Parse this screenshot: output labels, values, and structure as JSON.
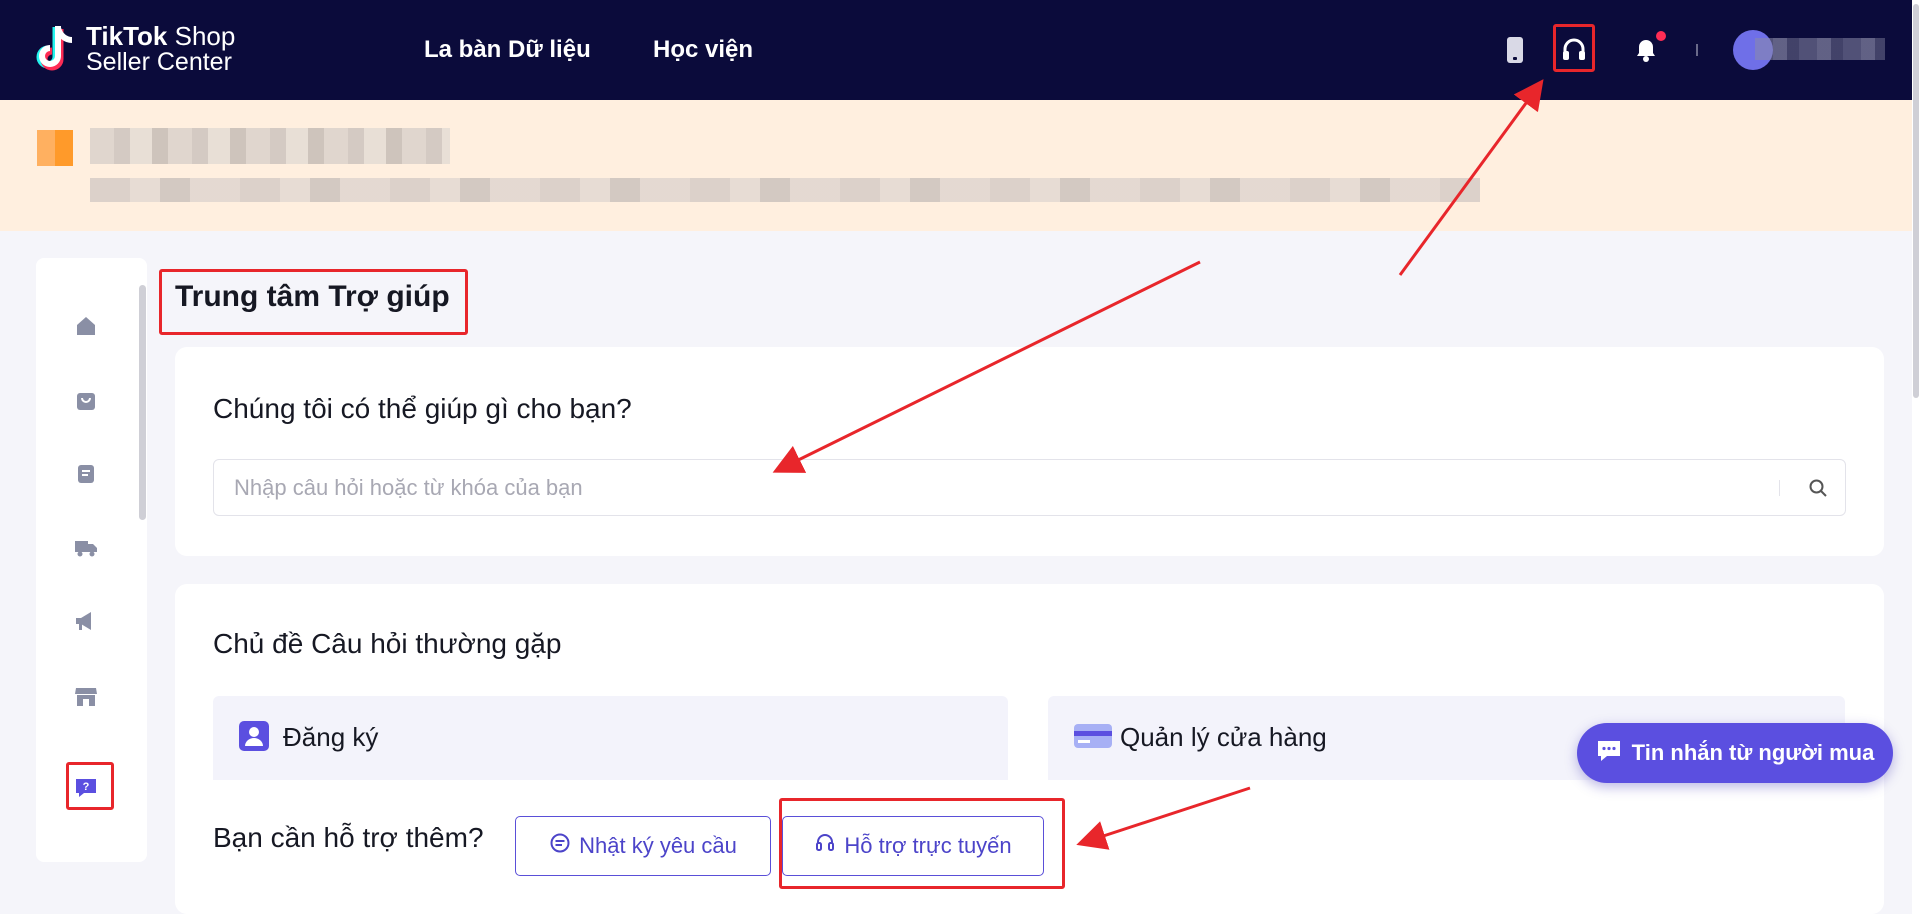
{
  "header": {
    "logo_line1_bold": "TikTok",
    "logo_line1_rest": " Shop",
    "logo_line2": "Seller Center",
    "nav": [
      "La bàn Dữ liệu",
      "Học viện"
    ],
    "icons": [
      "mobile-icon",
      "headset-icon",
      "bell-icon",
      "avatar"
    ]
  },
  "page": {
    "title": "Trung tâm Trợ giúp"
  },
  "search": {
    "title": "Chúng tôi có thể giúp gì cho bạn?",
    "placeholder": "Nhập câu hỏi hoặc từ khóa của bạn"
  },
  "faq": {
    "title": "Chủ đề Câu hỏi thường gặp",
    "topics": [
      {
        "label": "Đăng ký",
        "icon": "user-badge-icon"
      },
      {
        "label": "Quản lý cửa hàng",
        "icon": "card-icon"
      }
    ]
  },
  "support": {
    "question": "Bạn cần hỗ trợ thêm?",
    "request_log": "Nhật ký yêu cầu",
    "online_support": "Hỗ trợ trực tuyến"
  },
  "chat_fab": {
    "label": "Tin nhắn từ người mua"
  },
  "sidebar": {
    "items": [
      "home-icon",
      "shopping-bag-icon",
      "orders-icon",
      "shipping-truck-icon",
      "megaphone-icon",
      "store-icon",
      "help-icon"
    ]
  },
  "colors": {
    "topbar": "#0b0b3b",
    "accent": "#5b4fe0",
    "banner": "#ffefdf",
    "annotation": "#e8262b"
  }
}
